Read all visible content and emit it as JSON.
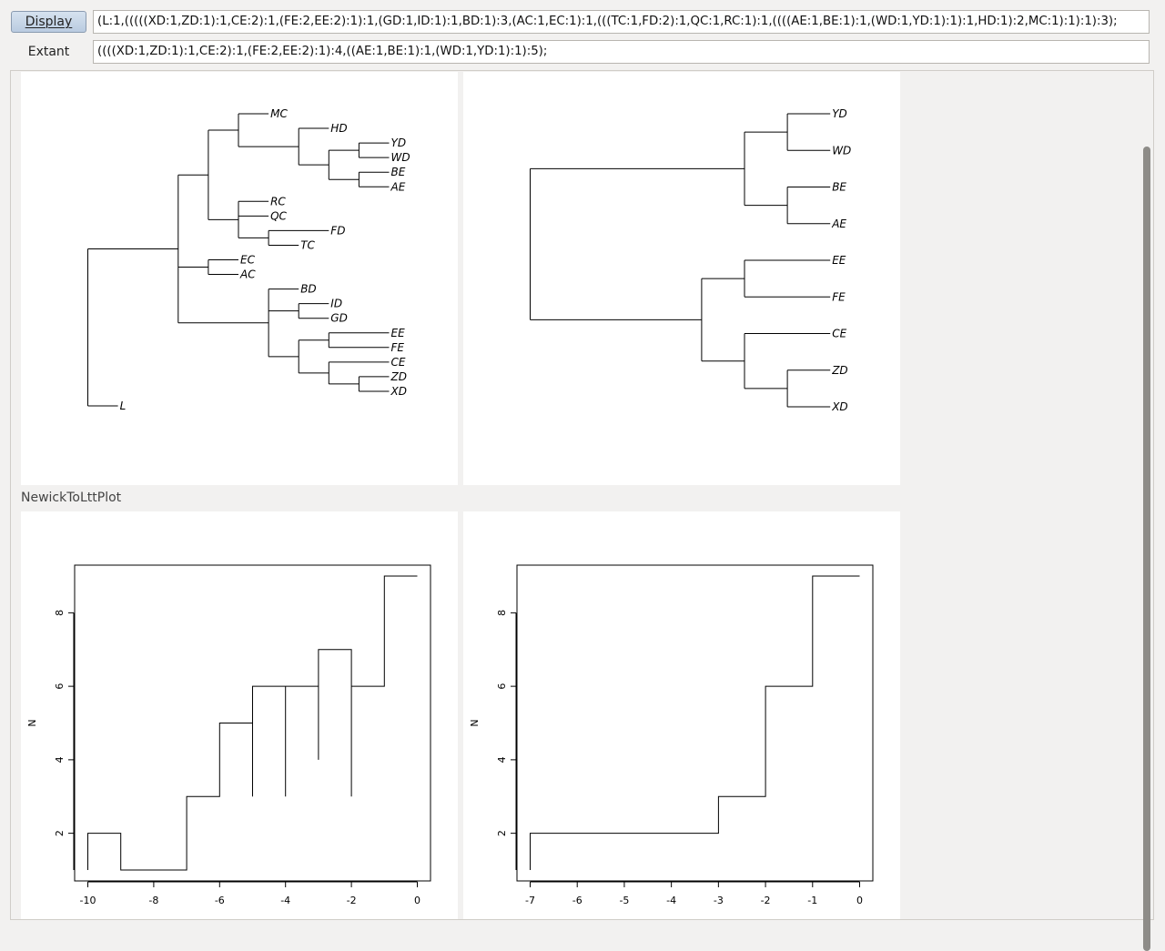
{
  "toolbar": {
    "display_label": "Display",
    "display_newick": "(L:1,(((((XD:1,ZD:1):1,CE:2):1,(FE:2,EE:2):1):1,(GD:1,ID:1):1,BD:1):3,(AC:1,EC:1):1,(((TC:1,FD:2):1,QC:1,RC:1):1,((((AE:1,BE:1):1,(WD:1,YD:1):1):1,HD:1):2,MC:1):1):1):3);",
    "extant_label": "Extant",
    "extant_newick": "((((XD:1,ZD:1):1,CE:2):1,(FE:2,EE:2):1):4,((AE:1,BE:1):1,(WD:1,YD:1):1):5);"
  },
  "trees": {
    "full": {
      "labels": [
        "MC",
        "HD",
        "YD",
        "WD",
        "BE",
        "AE",
        "RC",
        "QC",
        "FD",
        "TC",
        "EC",
        "AC",
        "BD",
        "ID",
        "GD",
        "EE",
        "FE",
        "CE",
        "ZD",
        "XD",
        "L"
      ]
    },
    "extant": {
      "labels": [
        "YD",
        "WD",
        "BE",
        "AE",
        "EE",
        "FE",
        "CE",
        "ZD",
        "XD"
      ]
    }
  },
  "section_title": "NewickToLttPlot",
  "chart_data": [
    {
      "type": "line",
      "title": "",
      "xlabel": "",
      "ylabel": "N",
      "xlim": [
        -10,
        0
      ],
      "ylim": [
        1,
        9
      ],
      "x_ticks": [
        "-10",
        "-8",
        "-6",
        "-4",
        "-2",
        "0"
      ],
      "y_ticks": [
        "2",
        "4",
        "6",
        "8"
      ],
      "points": [
        [
          -10,
          1
        ],
        [
          -10,
          2
        ],
        [
          -9,
          2
        ],
        [
          -9,
          1
        ],
        [
          -7,
          1
        ],
        [
          -7,
          3
        ],
        [
          -6,
          3
        ],
        [
          -6,
          5
        ],
        [
          -5,
          5
        ],
        [
          -5,
          3
        ],
        [
          -5,
          6
        ],
        [
          -4,
          6
        ],
        [
          -4,
          3
        ],
        [
          -4,
          6
        ],
        [
          -3,
          6
        ],
        [
          -3,
          4
        ],
        [
          -3,
          7
        ],
        [
          -2,
          7
        ],
        [
          -2,
          3
        ],
        [
          -2,
          6
        ],
        [
          -1,
          6
        ],
        [
          -1,
          9
        ],
        [
          0,
          9
        ]
      ]
    },
    {
      "type": "line",
      "title": "",
      "xlabel": "",
      "ylabel": "N",
      "xlim": [
        -7,
        0
      ],
      "ylim": [
        1,
        9
      ],
      "x_ticks": [
        "-7",
        "-6",
        "-5",
        "-4",
        "-3",
        "-2",
        "-1",
        "0"
      ],
      "y_ticks": [
        "2",
        "4",
        "6",
        "8"
      ],
      "points": [
        [
          -7,
          1
        ],
        [
          -7,
          2
        ],
        [
          -3,
          2
        ],
        [
          -3,
          3
        ],
        [
          -2,
          3
        ],
        [
          -2,
          6
        ],
        [
          -1,
          6
        ],
        [
          -1,
          9
        ],
        [
          0,
          9
        ]
      ]
    }
  ]
}
